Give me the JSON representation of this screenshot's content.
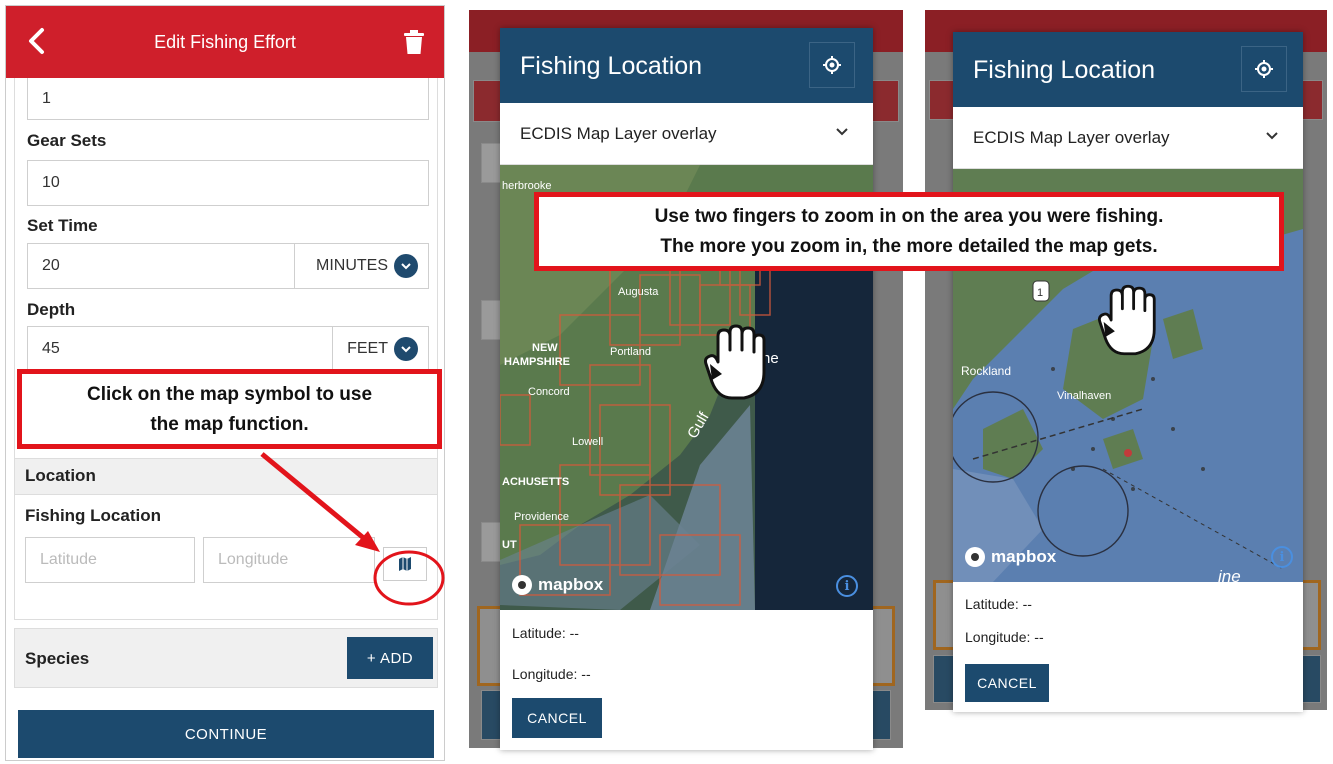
{
  "panel1": {
    "header_title": "Edit Fishing Effort",
    "prev_field_value": "1",
    "gear_sets_label": "Gear Sets",
    "gear_sets_value": "10",
    "set_time_label": "Set Time",
    "set_time_value": "20",
    "set_time_unit": "MINUTES",
    "depth_label": "Depth",
    "depth_value": "45",
    "depth_unit": "FEET",
    "location_section": "Location",
    "fishing_location_label": "Fishing Location",
    "latitude_placeholder": "Latitude",
    "longitude_placeholder": "Longitude",
    "species_section": "Species",
    "add_button": "+ ADD",
    "continue_button": "CONTINUE",
    "callout_line1": "Click on the map symbol to use",
    "callout_line2": "the map function."
  },
  "map_modal": {
    "title": "Fishing Location",
    "layer_select": "ECDIS Map Layer overlay",
    "latitude_text": "Latitude: --",
    "longitude_text": "Longitude: --",
    "cancel_button": "CANCEL",
    "mapbox_label": "mapbox"
  },
  "map_labels": {
    "herbrooke": "herbrooke",
    "augusta": "Augusta",
    "new": "NEW",
    "hampshire": "HAMPSHIRE",
    "portland": "Portland",
    "concord": "Concord",
    "lowell": "Lowell",
    "achusetts": "ACHUSETTS",
    "providence": "Providence",
    "gulf": "Gulf",
    "ne": "ne",
    "ut": "UT",
    "rockland": "Rockland",
    "vinalhaven": "Vinalhaven",
    "ine": "ine"
  },
  "zoom_callout": {
    "line1": "Use two fingers to zoom in on the area you were fishing.",
    "line2": "The more you zoom in, the more detailed the map gets."
  },
  "colors": {
    "header_red": "#cf1f2b",
    "navy": "#1c4a6e",
    "callout_red": "#e2141b"
  },
  "icons": [
    "back-arrow-icon",
    "trash-icon",
    "chevron-down-icon",
    "map-icon",
    "location-target-icon",
    "info-icon",
    "hand-pointer-icon",
    "mapbox-logo-icon"
  ]
}
